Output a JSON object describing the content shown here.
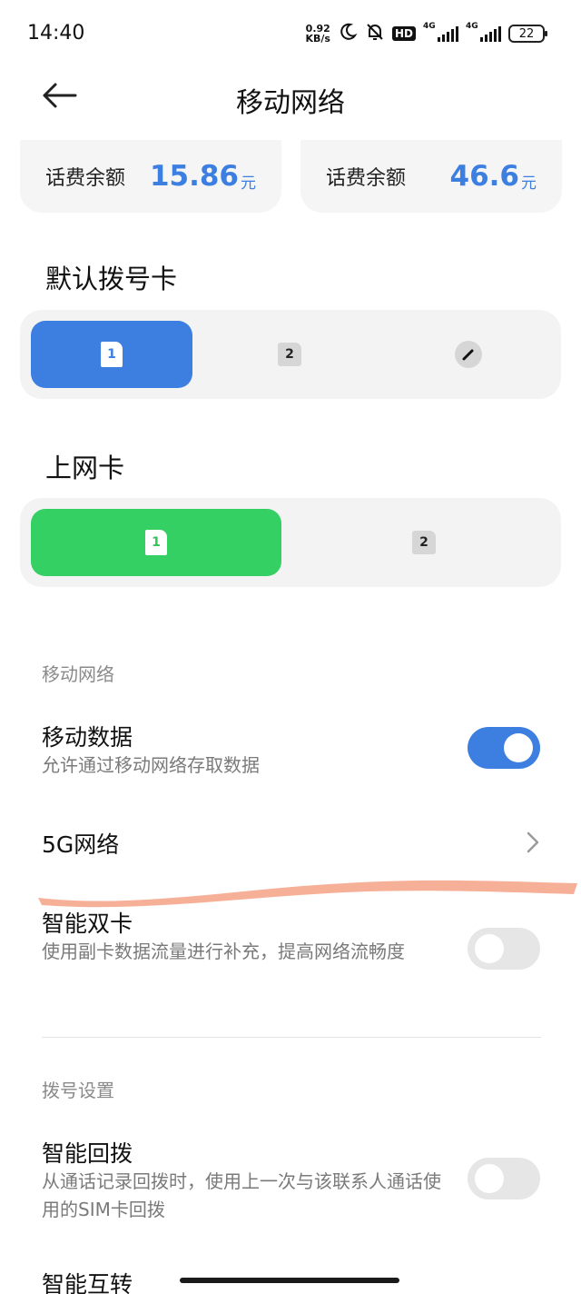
{
  "status_bar": {
    "time": "14:40",
    "net_speed_value": "0.92",
    "net_speed_unit": "KB/s",
    "hd_label": "HD",
    "sim1_network": "4G",
    "sim2_network": "4G",
    "battery": "22",
    "icons": [
      "moon-icon",
      "bell-off-icon",
      "signal-icon",
      "battery-icon"
    ]
  },
  "header": {
    "title": "移动网络",
    "back_icon": "arrow-left-icon"
  },
  "balances": [
    {
      "label": "话费余额",
      "amount": "15.86",
      "unit": "元"
    },
    {
      "label": "话费余额",
      "amount": "46.6",
      "unit": "元"
    }
  ],
  "default_dial": {
    "title": "默认拨号卡",
    "options": [
      {
        "label": "1",
        "selected": true
      },
      {
        "label": "2",
        "selected": false
      },
      {
        "icon": "pencil-icon",
        "selected": false
      }
    ]
  },
  "data_sim": {
    "title": "上网卡",
    "options": [
      {
        "label": "1",
        "selected": true
      },
      {
        "label": "2",
        "selected": false
      }
    ]
  },
  "mobile_network_section": {
    "label": "移动网络",
    "mobile_data": {
      "title": "移动数据",
      "subtitle": "允许通过移动网络存取数据",
      "enabled": true
    },
    "network_5g": {
      "title": "5G网络"
    },
    "smart_dual": {
      "title": "智能双卡",
      "subtitle": "使用副卡数据流量进行补充，提高网络流畅度",
      "enabled": false
    }
  },
  "dial_settings_section": {
    "label": "拨号设置",
    "smart_callback": {
      "title": "智能回拨",
      "subtitle": "从通话记录回拨时，使用上一次与该联系人通话使用的SIM卡回拨",
      "enabled": false
    },
    "smart_transfer": {
      "title": "智能互转"
    }
  },
  "colors": {
    "accent_blue": "#3d7fe0",
    "accent_green": "#35c45a",
    "annotation_stroke": "#f5a98e"
  }
}
